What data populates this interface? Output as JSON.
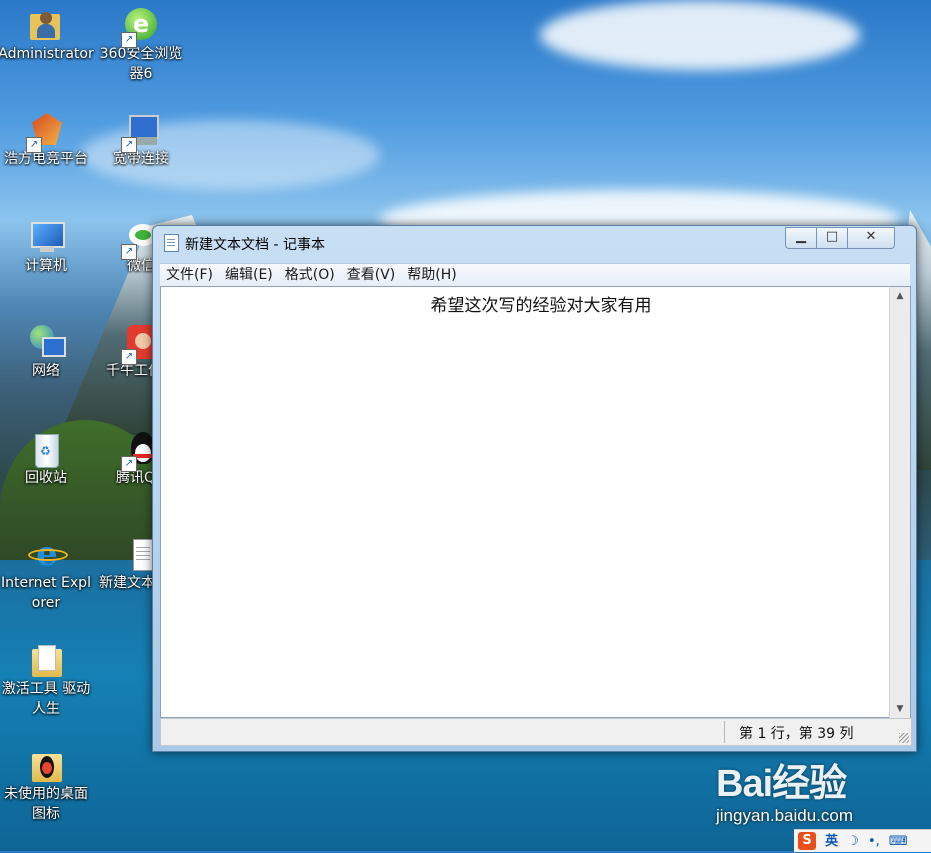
{
  "desktop": {
    "icons": [
      {
        "label": "Administrator",
        "icon": "user-folder-icon"
      },
      {
        "label": "360安全浏览器6",
        "icon": "browser-360-icon"
      },
      {
        "label": "浩方电竞平台",
        "icon": "game-platform-icon"
      },
      {
        "label": "宽带连接",
        "icon": "broadband-connection-icon"
      },
      {
        "label": "计算机",
        "icon": "computer-icon"
      },
      {
        "label": "微信",
        "icon": "wechat-icon"
      },
      {
        "label": "网络",
        "icon": "network-icon"
      },
      {
        "label": "千牛工作台",
        "icon": "qianniu-icon"
      },
      {
        "label": "回收站",
        "icon": "recycle-bin-icon"
      },
      {
        "label": "腾讯QQ",
        "icon": "qq-icon"
      },
      {
        "label": "Internet Explorer",
        "icon": "internet-explorer-icon"
      },
      {
        "label": "新建文本文档",
        "icon": "text-document-icon"
      },
      {
        "label": "激活工具 驱动人生",
        "icon": "folder-icon"
      },
      {
        "label": "未使用的桌面图标",
        "icon": "unused-icons-folder-icon"
      }
    ]
  },
  "window": {
    "title": "新建文本文档 - 记事本",
    "menu": [
      "文件(F)",
      "编辑(E)",
      "格式(O)",
      "查看(V)",
      "帮助(H)"
    ],
    "content": "希望这次写的经验对大家有用",
    "status": "第 1 行，第 39 列",
    "controls": {
      "minimize": "▁",
      "maximize": "□",
      "close": "✕"
    }
  },
  "watermark": {
    "logo": "Bai经验",
    "site": "jingyan.baidu.com"
  },
  "tray": {
    "ime_logo": "S",
    "ime_lang": "英",
    "items": [
      "☽",
      "•,",
      "⌨"
    ]
  }
}
